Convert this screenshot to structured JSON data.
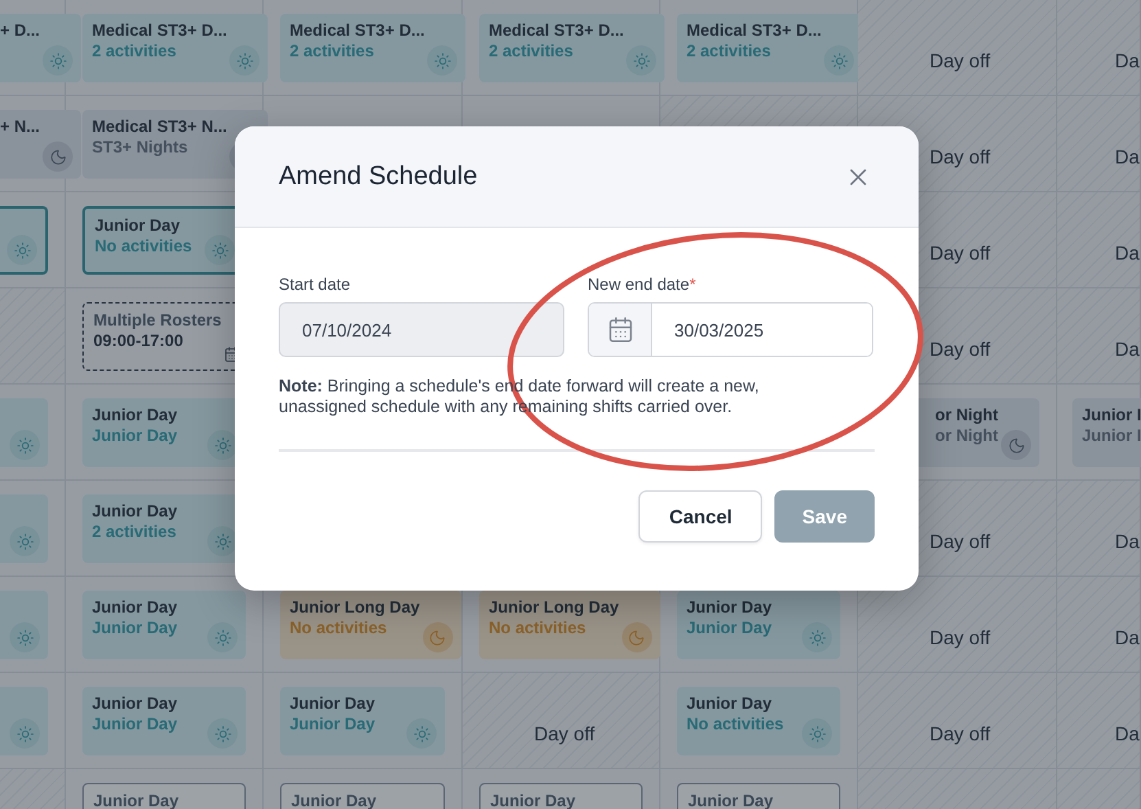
{
  "schedule_grid": {
    "rows": [
      {
        "cells": [
          {
            "kind": "day",
            "selected": false,
            "title": "+ D..."
          },
          {
            "kind": "day",
            "selected": false,
            "title": "Medical ST3+ D...",
            "subtitle": "2 activities"
          },
          {
            "kind": "day",
            "selected": false,
            "title": "Medical ST3+ D...",
            "subtitle": "2 activities"
          },
          {
            "kind": "day",
            "selected": false,
            "title": "Medical ST3+ D...",
            "subtitle": "2 activities"
          },
          {
            "kind": "day",
            "selected": false,
            "title": "Medical ST3+ D...",
            "subtitle": "2 activities"
          },
          {
            "kind": "off",
            "text": "Day off"
          },
          {
            "kind": "off",
            "text": "Da"
          }
        ]
      },
      {
        "cells": [
          {
            "kind": "night",
            "selected": false,
            "title": "+ N..."
          },
          {
            "kind": "night",
            "selected": false,
            "title": "Medical ST3+ N...",
            "subtitle": "ST3+ Nights"
          },
          {
            "kind": "covered"
          },
          {
            "kind": "covered"
          },
          {
            "kind": "blank"
          },
          {
            "kind": "off",
            "text": "Day off"
          },
          {
            "kind": "off",
            "text": "Da"
          }
        ]
      },
      {
        "cells": [
          {
            "kind": "day",
            "selected": true
          },
          {
            "kind": "day",
            "selected": true,
            "title": "Junior Day",
            "subtitle": "No activities"
          },
          {
            "kind": "covered"
          },
          {
            "kind": "covered"
          },
          {
            "kind": "covered"
          },
          {
            "kind": "off",
            "text": "Day off"
          },
          {
            "kind": "off",
            "text": "Da"
          }
        ]
      },
      {
        "cells": [
          {
            "kind": "blank"
          },
          {
            "kind": "roster",
            "selected": false,
            "title": "Multiple Rosters",
            "subtitle": "09:00-17:00"
          },
          {
            "kind": "covered"
          },
          {
            "kind": "covered"
          },
          {
            "kind": "covered"
          },
          {
            "kind": "off",
            "text": "Day off"
          },
          {
            "kind": "off",
            "text": "Da"
          }
        ]
      },
      {
        "cells": [
          {
            "kind": "day",
            "selected": false
          },
          {
            "kind": "day",
            "selected": false,
            "title": "Junior Day",
            "subtitle": "Junior Day"
          },
          {
            "kind": "covered"
          },
          {
            "kind": "covered"
          },
          {
            "kind": "covered"
          },
          {
            "kind": "night",
            "selected": false,
            "title": "or Night",
            "subtitle": "or Night",
            "partial": true
          },
          {
            "kind": "night",
            "selected": false,
            "title": "Junior I",
            "subtitle": "Junior I"
          }
        ]
      },
      {
        "cells": [
          {
            "kind": "day",
            "selected": false
          },
          {
            "kind": "day",
            "selected": false,
            "title": "Junior Day",
            "subtitle": "2 activities"
          },
          {
            "kind": "covered"
          },
          {
            "kind": "covered"
          },
          {
            "kind": "covered"
          },
          {
            "kind": "off",
            "text": "Day off"
          },
          {
            "kind": "off",
            "text": "Da"
          }
        ]
      },
      {
        "cells": [
          {
            "kind": "day",
            "selected": false
          },
          {
            "kind": "day",
            "selected": false,
            "title": "Junior Day",
            "subtitle": "Junior Day"
          },
          {
            "kind": "long",
            "selected": false,
            "title": "Junior Long Day",
            "subtitle": "No activities"
          },
          {
            "kind": "long",
            "selected": false,
            "title": "Junior Long Day",
            "subtitle": "No activities"
          },
          {
            "kind": "day",
            "selected": false,
            "title": "Junior Day",
            "subtitle": "Junior Day"
          },
          {
            "kind": "off",
            "text": "Day off"
          },
          {
            "kind": "off",
            "text": "Da"
          }
        ]
      },
      {
        "cells": [
          {
            "kind": "day",
            "selected": false
          },
          {
            "kind": "day",
            "selected": false,
            "title": "Junior Day",
            "subtitle": "Junior Day"
          },
          {
            "kind": "day",
            "selected": false,
            "title": "Junior Day",
            "subtitle": "Junior Day"
          },
          {
            "kind": "off",
            "text": "Day off"
          },
          {
            "kind": "day",
            "selected": false,
            "title": "Junior Day",
            "subtitle": "No activities"
          },
          {
            "kind": "off",
            "text": "Day off"
          },
          {
            "kind": "off",
            "text": "Da"
          }
        ]
      },
      {
        "cells": [
          {
            "kind": "blank"
          },
          {
            "kind": "open",
            "selected": false,
            "title": "Junior Day"
          },
          {
            "kind": "open",
            "selected": false,
            "title": "Junior Day"
          },
          {
            "kind": "open",
            "selected": false,
            "title": "Junior Day"
          },
          {
            "kind": "open",
            "selected": false,
            "title": "Junior Day"
          },
          {
            "kind": "blank"
          },
          {
            "kind": "blank"
          }
        ]
      }
    ]
  },
  "modal": {
    "title": "Amend Schedule",
    "start_date": {
      "label": "Start date",
      "value": "07/10/2024",
      "disabled": true
    },
    "end_date": {
      "label": "New end date",
      "required_mark": "*",
      "value": "30/03/2025"
    },
    "note": "**Note:** Bringing a schedule's end date forward will create a new, unassigned schedule with any remaining shifts carried over.",
    "buttons": [
      {
        "label": "Cancel",
        "kind": "secondary",
        "disabled": false
      },
      {
        "label": "Save",
        "kind": "primary",
        "disabled": true
      }
    ]
  }
}
